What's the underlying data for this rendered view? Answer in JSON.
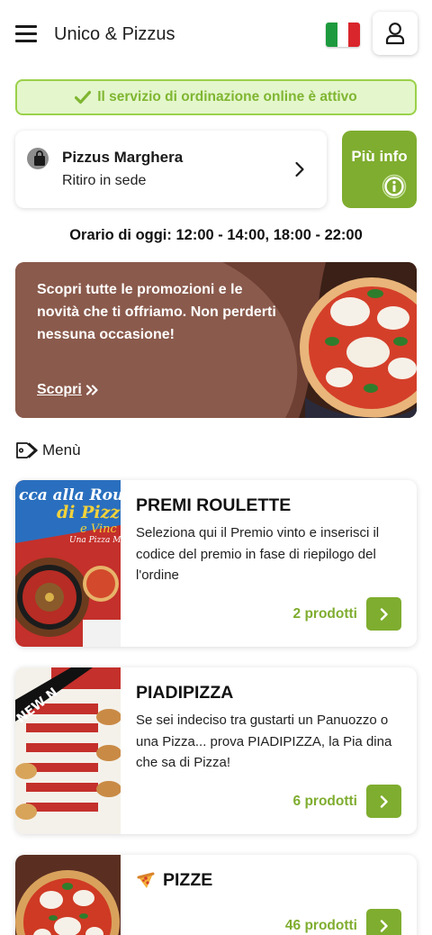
{
  "header": {
    "title": "Unico & Pizzus",
    "flag_colors": [
      "#1e9a3e",
      "#ffffff",
      "#d9262c"
    ]
  },
  "status": {
    "text": "Il servizio di ordinazione online è attivo"
  },
  "store": {
    "name": "Pizzus Marghera",
    "mode": "Ritiro in sede"
  },
  "info_button": {
    "label": "Più info"
  },
  "hours": {
    "text": "Orario di oggi: 12:00 - 14:00, 18:00 - 22:00"
  },
  "promo": {
    "text": "Scopri tutte le promozioni e le novità che ti offriamo. Non perderti nessuna occasione!",
    "link": "Scopri"
  },
  "menu": {
    "label": "Menù"
  },
  "categories": [
    {
      "title": "PREMI ROULETTE",
      "description": "Seleziona qui il Premio vinto e inserisci il codice del premio in fase di riepilogo del l'ordine",
      "count": "2 prodotti",
      "image_text_1": "cca alla Roule",
      "image_text_2": "di Pizz",
      "image_text_3": "e Vinc",
      "image_text_4": "Una Pizza Ma"
    },
    {
      "title": "PIADIPIZZA",
      "description": "Se sei indeciso tra gustarti un Panuozzo o una Pizza... prova PIADIPIZZA, la Pia dina che sa di Pizza!",
      "count": "6 prodotti",
      "image_ribbon": "NEW N"
    },
    {
      "title": "PIZZE",
      "description": "",
      "count": "46 prodotti"
    }
  ],
  "colors": {
    "accent": "#7fad2f",
    "banner_bg": "#e4f6cc",
    "banner_text": "#7fb631",
    "promo_bg": "#8a5a4c"
  }
}
